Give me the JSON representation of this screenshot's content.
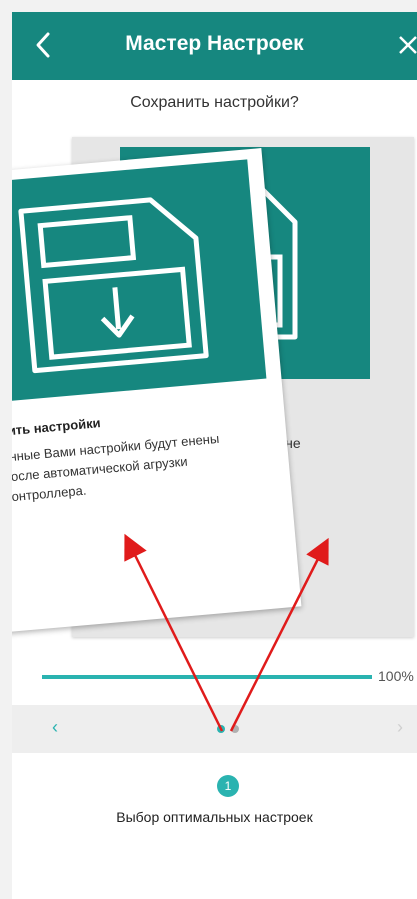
{
  "header": {
    "title": "Мастер Настроек",
    "back_icon": "chevron-left-icon",
    "close_icon": "close-icon",
    "color": "#16877f"
  },
  "subtitle": "Сохранить настройки?",
  "card_back": {
    "fragment_text": "ь не",
    "icon": "floppy-save-icon"
  },
  "card_front": {
    "title": "нить настройки",
    "text": "анные Вами настройки будут енены после автоматической агрузки контроллера.",
    "icon": "floppy-save-icon"
  },
  "progress": {
    "value": 100,
    "label": "100%",
    "color": "#2ab3b0"
  },
  "pager": {
    "prev_icon": "chevron-left-icon",
    "next_icon": "chevron-right-icon",
    "dots_total": 2,
    "active_index": 0
  },
  "step": {
    "number": "1",
    "label": "Выбор оптимальных настроек"
  },
  "annotation": {
    "arrow_color": "#e01b1b"
  }
}
